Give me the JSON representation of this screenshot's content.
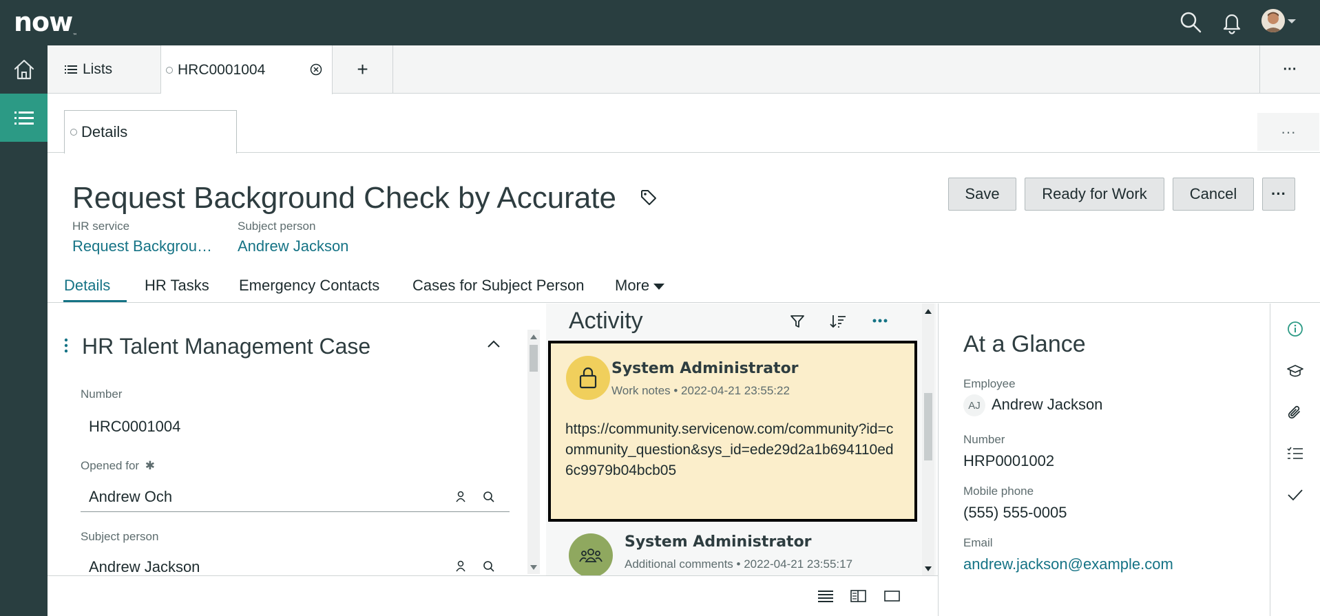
{
  "topbar": {
    "logo": "now",
    "logo_tm": "™",
    "icons": [
      "search-icon",
      "bell-icon",
      "user-avatar"
    ]
  },
  "tabs": {
    "lists_label": "Lists",
    "record_label": "HRC0001004",
    "add_label": "+",
    "more_label": "···"
  },
  "subtab": {
    "details_label": "Details",
    "more_label": "···"
  },
  "header": {
    "title": "Request Background Check by Accurate",
    "hr_service_label": "HR service",
    "hr_service_value": "Request Backgrou…",
    "subject_label": "Subject person",
    "subject_value": "Andrew Jackson"
  },
  "buttons": {
    "save": "Save",
    "ready": "Ready for Work",
    "cancel": "Cancel",
    "more": "···"
  },
  "form_tabs": {
    "details": "Details",
    "hr_tasks": "HR Tasks",
    "emergency": "Emergency Contacts",
    "cases": "Cases for Subject Person",
    "more": "More"
  },
  "form": {
    "section_title": "HR Talent Management Case",
    "number_label": "Number",
    "number_value": "HRC0001004",
    "opened_for_label": "Opened for",
    "required_mark": "✱",
    "opened_for_value": "Andrew Och",
    "subject_label": "Subject person",
    "subject_value": "Andrew Jackson"
  },
  "activity": {
    "title": "Activity",
    "entries": [
      {
        "author": "System Administrator",
        "meta": "Work notes • 2022-04-21 23:55:22",
        "body": "https://community.servicenow.com/community?id=community_question&sys_id=ede29d2a1b694110ed6c9979b04bcb05",
        "icon": "lock-icon"
      },
      {
        "author": "System Administrator",
        "meta": "Additional comments • 2022-04-21 23:55:17",
        "icon": "group-icon"
      }
    ]
  },
  "glance": {
    "title": "At a Glance",
    "employee_label": "Employee",
    "employee_initials": "AJ",
    "employee_value": "Andrew Jackson",
    "number_label": "Number",
    "number_value": "HRP0001002",
    "mobile_label": "Mobile phone",
    "mobile_value": "(555) 555-0005",
    "email_label": "Email",
    "email_value": "andrew.jackson@example.com"
  },
  "colors": {
    "topbar": "#293e40",
    "accent": "#157385",
    "rail_active": "#2c9a85",
    "work_note_bg": "#fbeecb",
    "lock_avatar": "#f0cf5c",
    "group_avatar": "#8fa85f"
  }
}
